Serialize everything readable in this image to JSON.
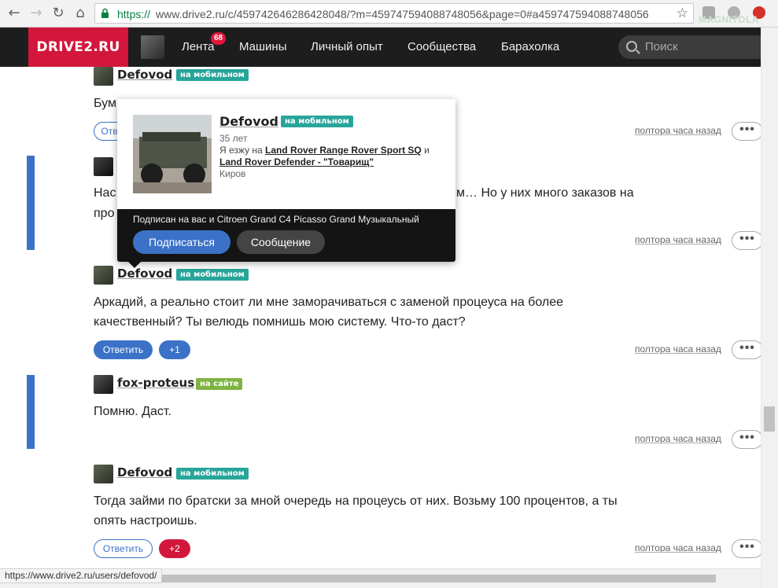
{
  "browser": {
    "url_scheme": "https://",
    "url_rest": "www.drive2.ru/c/459742646286428048/?m=459747594088748056&page=0#a459747594088748056",
    "watermark": "MAGNITOLA"
  },
  "site": {
    "logo": "DRIVE2.RU",
    "menu": [
      "Лента",
      "Машины",
      "Личный опыт",
      "Сообщества",
      "Барахолка"
    ],
    "feed_badge": "68",
    "search_placeholder": "Поиск"
  },
  "comments": [
    {
      "author": "Defovod",
      "status": "на мобильном",
      "text_lines": [
        "Бум"
      ],
      "reply": "Отв",
      "time": "полтора часа назад"
    },
    {
      "author": "",
      "status": "",
      "text_lines": [
        "Нас",
        "про"
      ],
      "text_right": "м… Но у них много заказов на",
      "time": "полтора часа назад"
    },
    {
      "author": "Defovod",
      "status": "на мобильном",
      "text_lines": [
        "Аркадий, а реально стоит ли мне заморачиваться с заменой процеуса на более",
        "качественный? Ты велюдь помнишь мою систему. Что-то даст?"
      ],
      "reply": "Ответить",
      "plus": "+1",
      "time": "полтора часа назад"
    },
    {
      "author": "fox-proteus",
      "status": "на сайте",
      "text_lines": [
        "Помню. Даст."
      ],
      "time": "полтора часа назад"
    },
    {
      "author": "Defovod",
      "status": "на мобильном",
      "text_lines": [
        "Тогда займи по братски за мной очередь на процеусь от них. Возьму 100 процентов, а ты",
        "опять настроишь."
      ],
      "reply": "Ответить",
      "plus": "+2",
      "time": "полтора часа назад"
    }
  ],
  "popup": {
    "name": "Defovod",
    "status": "на мобильном",
    "age": "35 лет",
    "drives_prefix": "Я езжу на ",
    "car1": "Land Rover Range Rover Sport SQ",
    "and": " и",
    "car2": "Land Rover Defender - \"Товарищ\"",
    "city": "Киров",
    "subscribed": "Подписан на вас и Citroen Grand C4 Picasso Grand Музыкальный",
    "follow_btn": "Подписаться",
    "message_btn": "Сообщение"
  },
  "more_glyph": "•••",
  "statusbar_url": "https://www.drive2.ru/users/defovod/",
  "colors": {
    "brand": "#d3173c",
    "accent": "#3b72c8",
    "mobile": "#28a59a",
    "site": "#7fb344"
  }
}
